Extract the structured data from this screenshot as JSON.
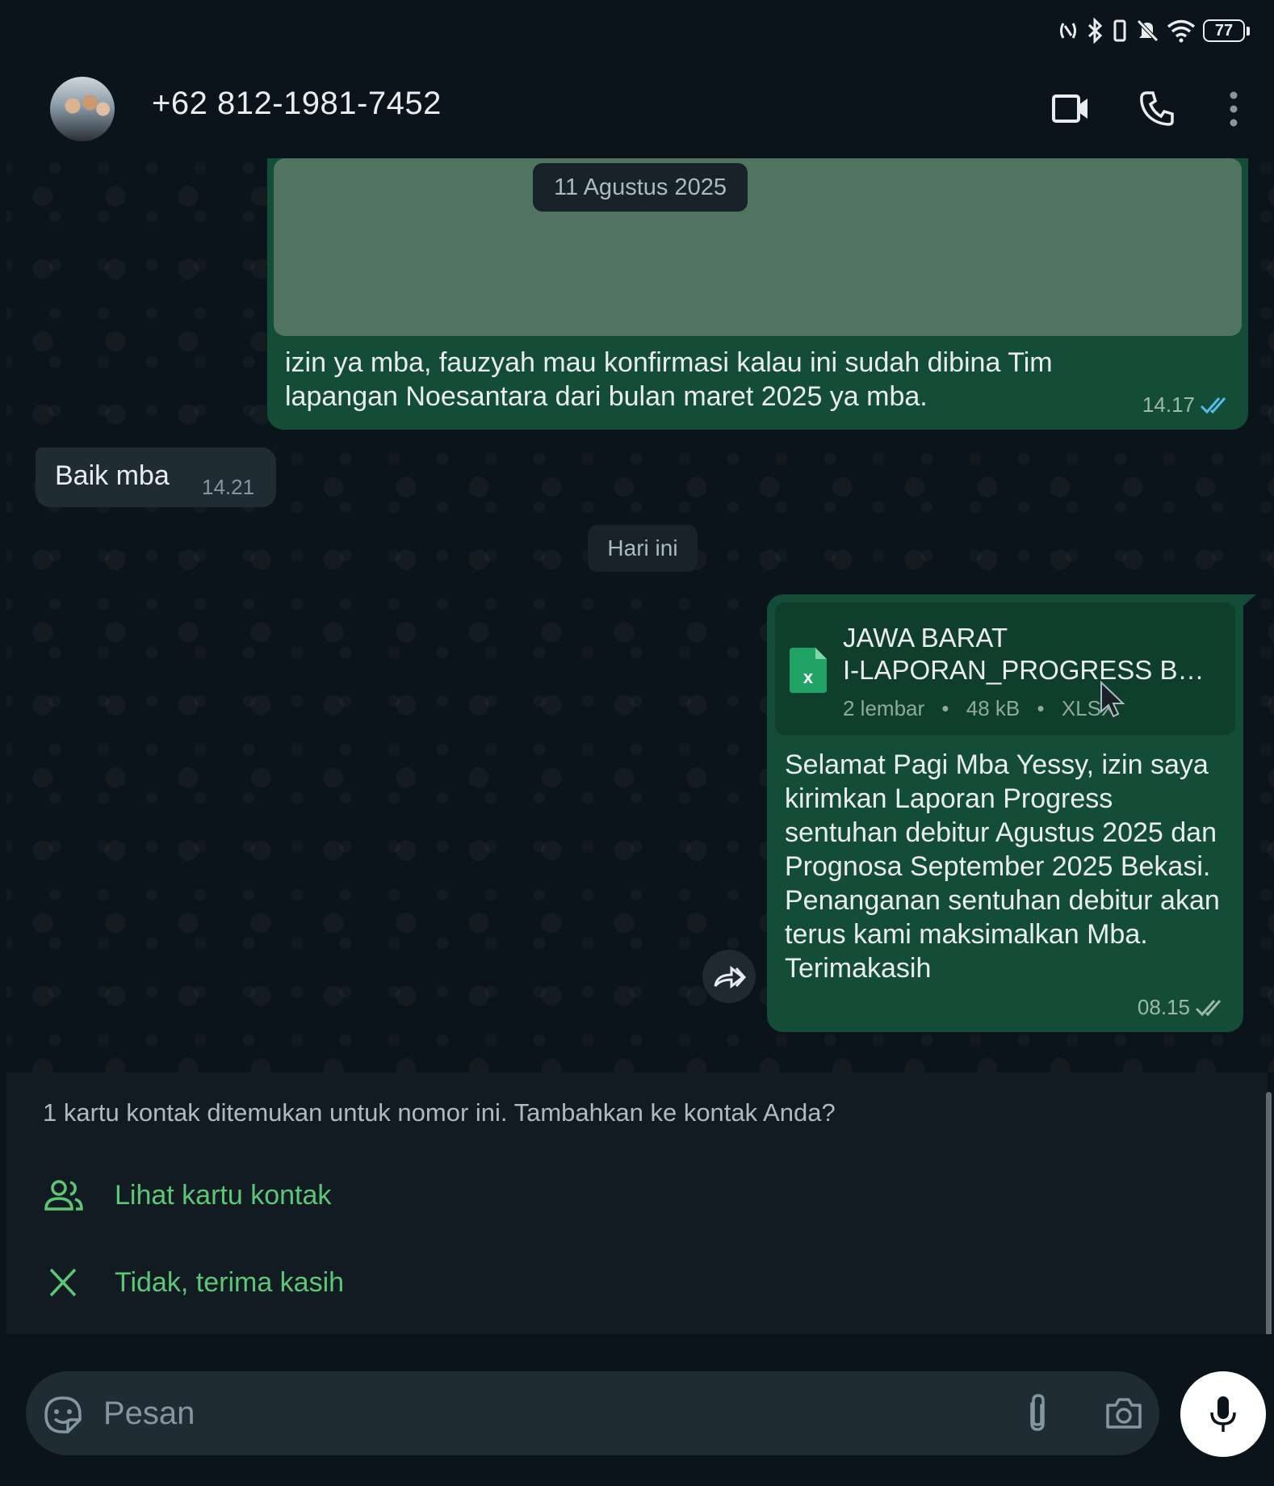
{
  "status_bar": {
    "battery_level": "77",
    "icons": [
      "nfc-icon",
      "bluetooth-icon",
      "vibrate-icon",
      "mute-icon",
      "wifi-icon",
      "battery-icon"
    ]
  },
  "header": {
    "contact_title": "+62 812-1981-7452",
    "actions": [
      "video-call-icon",
      "voice-call-icon",
      "more-options-icon"
    ]
  },
  "chat": {
    "date_separator_1": "11 Agustus 2025",
    "outgoing_msg_1": {
      "text": "izin ya mba, fauzyah mau konfirmasi kalau ini sudah dibina Tim lapangan Noesantara dari bulan maret 2025 ya mba.",
      "time": "14.17",
      "status": "read"
    },
    "incoming_msg_1": {
      "text": "Baik mba",
      "time": "14.21"
    },
    "date_separator_2": "Hari ini",
    "outgoing_msg_2": {
      "document": {
        "name_line1": "JAWA BARAT",
        "name_line2": "I-LAPORAN_PROGRESS B…",
        "pages": "2 lembar",
        "size": "48 kB",
        "type": "XLSX",
        "separator": "•"
      },
      "text": "Selamat Pagi Mba Yessy, izin saya kirimkan Laporan Progress sentuhan debitur Agustus 2025 dan Prognosa September 2025 Bekasi. Penanganan sentuhan debitur akan terus kami maksimalkan Mba. Terimakasih",
      "time": "08.15",
      "status": "delivered"
    }
  },
  "contact_panel": {
    "message": "1 kartu kontak ditemukan untuk nomor ini. Tambahkan ke kontak Anda?",
    "view_card_label": "Lihat kartu kontak",
    "dismiss_label": "Tidak, terima kasih"
  },
  "composer": {
    "placeholder": "Pesan",
    "value": ""
  },
  "colors": {
    "outgoing_bubble": "#144d37",
    "incoming_bubble": "#202c33",
    "accent_green": "#5cc777",
    "read_tick": "#53bdeb"
  }
}
